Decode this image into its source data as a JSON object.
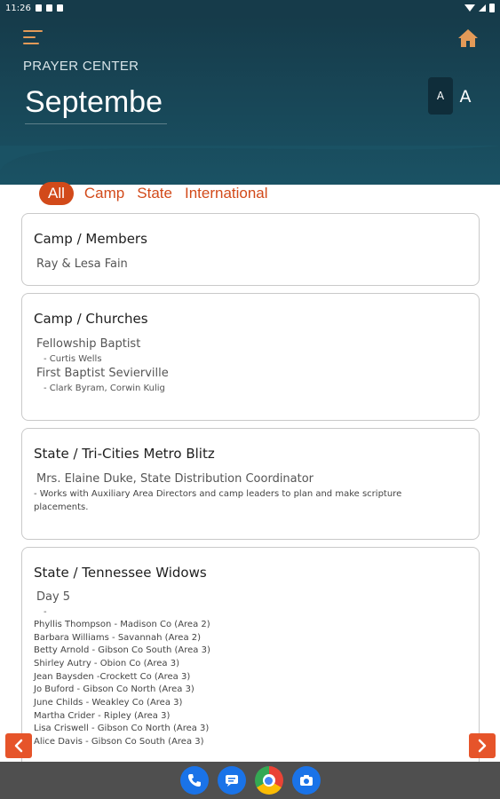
{
  "status_bar": {
    "time": "11:26"
  },
  "header": {
    "section_label": "PRAYER CENTER",
    "month_title": "Septembe",
    "font_small_label": "A",
    "font_large_label": "A"
  },
  "tabs": [
    "All",
    "Camp",
    "State",
    "International"
  ],
  "cards": {
    "members": {
      "title": "Camp / Members",
      "name": "Ray & Lesa Fain"
    },
    "churches": {
      "title": "Camp / Churches",
      "items": [
        {
          "name": "Fellowship Baptist",
          "detail": "- Curtis Wells"
        },
        {
          "name": "First Baptist Sevierville",
          "detail": "- Clark Byram, Corwin Kulig"
        }
      ]
    },
    "blitz": {
      "title": "State / Tri-Cities Metro Blitz",
      "name": "Mrs. Elaine Duke, State Distribution Coordinator",
      "detail": "- Works with Auxiliary Area Directors and camp leaders to plan and make scripture placements."
    },
    "widows": {
      "title": "State / Tennessee Widows",
      "day": "Day 5",
      "dash": "-",
      "names": [
        "Phyllis Thompson - Madison Co (Area 2)",
        "Barbara Williams - Savannah (Area 2)",
        "Betty Arnold - Gibson Co South (Area 3)",
        "Shirley Autry - Obion Co (Area 3)",
        "Jean Baysden -Crockett Co (Area 3)",
        "Jo Buford - Gibson Co North (Area 3)",
        "June Childs - Weakley Co (Area 3)",
        "Martha Crider - Ripley (Area 3)",
        "Lisa Criswell - Gibson Co North (Area 3)",
        "Alice Davis - Gibson Co South (Area 3)"
      ]
    }
  },
  "colors": {
    "header_dark": "#163b4a",
    "accent_orange": "#d24a1a",
    "nav_arrow": "#e6542a",
    "menu_icon": "#e39a58"
  },
  "icons": [
    "menu-icon",
    "home-icon",
    "prev-arrow-icon",
    "next-arrow-icon",
    "phone-icon",
    "messages-icon",
    "chrome-icon",
    "camera-icon"
  ]
}
